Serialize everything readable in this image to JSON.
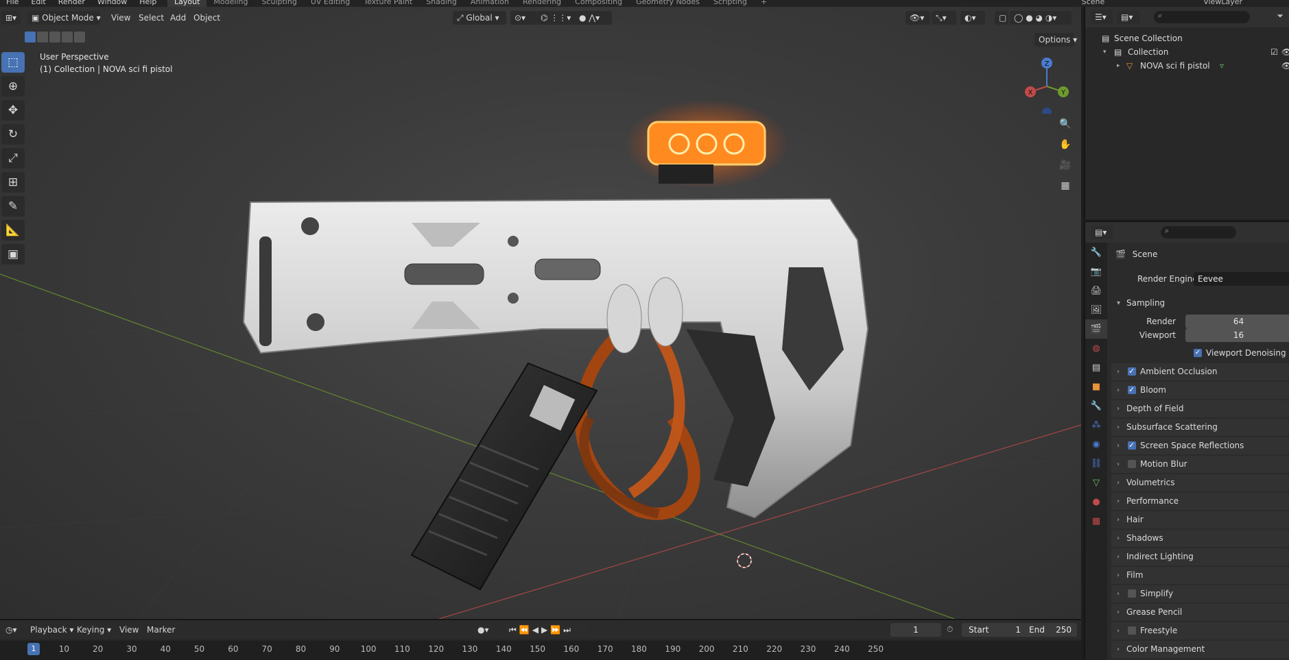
{
  "topbar": {
    "menus": [
      "File",
      "Edit",
      "Render",
      "Window",
      "Help"
    ],
    "workspaces": [
      "Layout",
      "Modeling",
      "Sculpting",
      "UV Editing",
      "Texture Paint",
      "Shading",
      "Animation",
      "Rendering",
      "Compositing",
      "Geometry Nodes",
      "Scripting",
      "+"
    ],
    "scene": "Scene",
    "view_layer": "ViewLayer"
  },
  "viewport": {
    "mode": "Object Mode",
    "menus": [
      "View",
      "Select",
      "Add",
      "Object"
    ],
    "transform_orientation": "Global",
    "options_label": "Options",
    "info_line1": "User Perspective",
    "info_line2": "(1) Collection | NOVA sci fi pistol",
    "gizmo_labels": {
      "x": "X",
      "y": "Y",
      "z": "Z"
    }
  },
  "outliner": {
    "scene_collection": "Scene Collection",
    "collection": "Collection",
    "object": "NOVA sci fi pistol"
  },
  "properties": {
    "context": "Scene",
    "render_engine_label": "Render Engine",
    "render_engine": "Eevee",
    "sampling": "Sampling",
    "render_label": "Render",
    "render_value": "64",
    "viewport_label": "Viewport",
    "viewport_value": "16",
    "viewport_denoising": "Viewport Denoising",
    "panels": [
      {
        "label": "Ambient Occlusion",
        "checkbox": true
      },
      {
        "label": "Bloom",
        "checkbox": true
      },
      {
        "label": "Depth of Field",
        "checkbox": null
      },
      {
        "label": "Subsurface Scattering",
        "checkbox": null
      },
      {
        "label": "Screen Space Reflections",
        "checkbox": true
      },
      {
        "label": "Motion Blur",
        "checkbox": false
      },
      {
        "label": "Volumetrics",
        "checkbox": null
      },
      {
        "label": "Performance",
        "checkbox": null
      },
      {
        "label": "Hair",
        "checkbox": null
      },
      {
        "label": "Shadows",
        "checkbox": null
      },
      {
        "label": "Indirect Lighting",
        "checkbox": null
      },
      {
        "label": "Film",
        "checkbox": null
      },
      {
        "label": "Simplify",
        "checkbox": false
      },
      {
        "label": "Grease Pencil",
        "checkbox": null
      },
      {
        "label": "Freestyle",
        "checkbox": false
      },
      {
        "label": "Color Management",
        "checkbox": null
      }
    ]
  },
  "timeline": {
    "menus": [
      "Playback",
      "Keying",
      "View",
      "Marker"
    ],
    "current_frame": "1",
    "start_label": "Start",
    "start_value": "1",
    "end_label": "End",
    "end_value": "250",
    "ticks": [
      "1",
      "10",
      "20",
      "30",
      "40",
      "50",
      "60",
      "70",
      "80",
      "90",
      "100",
      "110",
      "120",
      "130",
      "140",
      "150",
      "160",
      "170",
      "180",
      "190",
      "200",
      "210",
      "220",
      "230",
      "240",
      "250"
    ]
  },
  "colors": {
    "accent": "#4772b3",
    "glow": "#ff7a1a",
    "axis_x": "#c24a4a",
    "axis_y": "#6e9a2e"
  }
}
